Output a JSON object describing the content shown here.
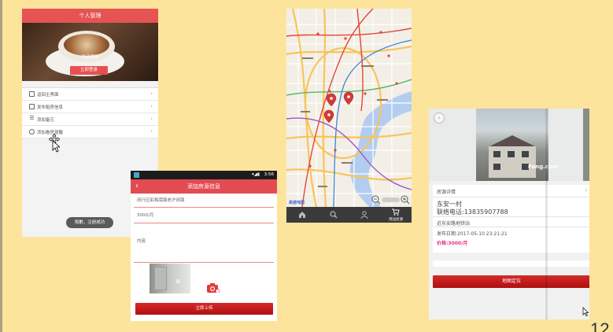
{
  "slide_number": "12",
  "screen_personal": {
    "title": "个人管理",
    "welcome": "欢迎使用",
    "login_button": "立即登录",
    "menu": [
      {
        "label": "返回主界面",
        "icon": "home-icon"
      },
      {
        "label": "发布租房信息",
        "icon": "edit-icon"
      },
      {
        "label": "添加备忘",
        "icon": "list-icon"
      },
      {
        "label": "添加看房提醒",
        "icon": "clock-icon"
      }
    ],
    "toast": "抱歉，注册成功"
  },
  "screen_add": {
    "status_time": "3:56",
    "title": "添加房源信息",
    "address_value": "闵行区虹梅南路老沪闵路",
    "price_value": "3000/月",
    "content_placeholder": "内容",
    "upload_button": "立即上传"
  },
  "screen_map": {
    "brand": "高德地图",
    "tabs": [
      {
        "label": "",
        "icon": "home-icon"
      },
      {
        "label": "",
        "icon": "search-icon"
      },
      {
        "label": "",
        "icon": "person-icon"
      },
      {
        "label": "周边房源",
        "icon": "cart-icon"
      }
    ],
    "colors": {
      "land": "#f3efe6",
      "water": "#b3cdf0",
      "road_major": "#f7c55a",
      "metro_red": "#e3453b",
      "metro_green": "#4fb860",
      "metro_blue": "#4a8ad6",
      "marker": "#d23a3a"
    }
  },
  "screen_detail": {
    "section_title": "房源详情",
    "watermark": "Fang.com",
    "name": "东安一村",
    "phone": "联络电话:13835907788",
    "nearby": "近东安路地铁站",
    "date": "发布日期:2017-05-10 23:21:21",
    "price": "价格:3000/月",
    "locate_button": "地图定位"
  }
}
